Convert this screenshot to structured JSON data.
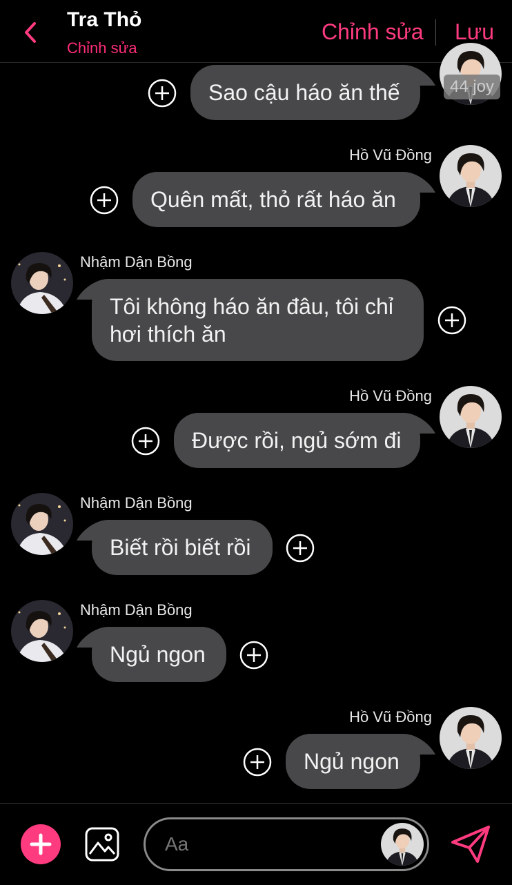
{
  "header": {
    "title": "Tra Thỏ",
    "subtitle": "Chỉnh sửa",
    "edit_label": "Chỉnh sửa",
    "save_label": "Lưu"
  },
  "colors": {
    "accent": "#ff3b7f",
    "bubble": "#48484a",
    "background": "#000000"
  },
  "badge_text": "44 joy",
  "messages": [
    {
      "text": "Sao cậu háo ăn thế"
    },
    {
      "sender": "Hồ Vũ Đồng",
      "text": "Quên mất, thỏ rất háo ăn"
    },
    {
      "sender": "Nhậm Dận Bồng",
      "text": "Tôi không háo ăn đâu, tôi chỉ hơi thích ăn"
    },
    {
      "sender": "Hồ Vũ Đồng",
      "text": "Được rồi, ngủ sớm đi"
    },
    {
      "sender": "Nhậm Dận Bồng",
      "text": "Biết rồi biết rồi"
    },
    {
      "sender": "Nhậm Dận Bồng",
      "text": "Ngủ ngon"
    },
    {
      "sender": "Hồ Vũ Đồng",
      "text": "Ngủ ngon"
    }
  ],
  "composer": {
    "placeholder": "Aa",
    "icons": [
      "plus-icon",
      "image-icon",
      "send-icon"
    ]
  }
}
